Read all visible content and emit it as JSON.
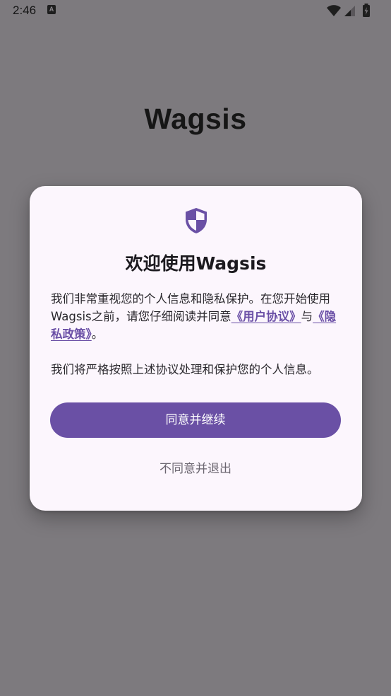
{
  "status_bar": {
    "time": "2:46",
    "notification_icon": "a-icon",
    "icons": [
      "wifi-icon",
      "signal-icon",
      "battery-icon"
    ]
  },
  "app": {
    "title": "Wagsis"
  },
  "dialog": {
    "icon": "shield-icon",
    "title": "欢迎使用Wagsis",
    "body_part1": "我们非常重视您的个人信息和隐私保护。在您开始使用Wagsis之前，请您仔细阅读并同意",
    "user_agreement_link": "《用户协议》",
    "body_and": "与",
    "privacy_policy_link": "《隐私政策》",
    "body_end": "。",
    "body_paragraph2": "我们将严格按照上述协议处理和保护您的个人信息。",
    "agree_button": "同意并继续",
    "decline_button": "不同意并退出"
  },
  "colors": {
    "accent": "#6a50a5",
    "scrim": "#7d7a7e",
    "dialog_background": "#fcf6fd"
  }
}
